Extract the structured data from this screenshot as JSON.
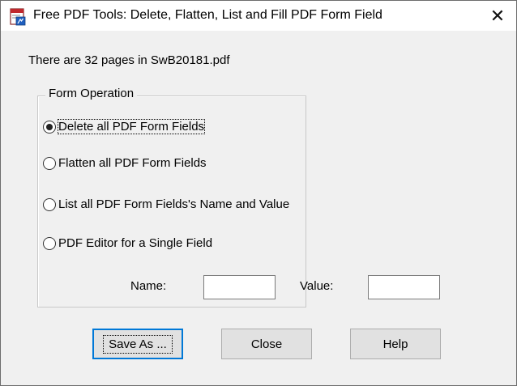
{
  "window": {
    "title": "Free PDF Tools: Delete, Flatten, List and Fill PDF Form Field",
    "app_icon": "pdf-tools-icon",
    "close_glyph": "✕"
  },
  "info": {
    "text": "There are 32 pages in SwB20181.pdf"
  },
  "form_operation": {
    "legend": "Form Operation",
    "options": [
      {
        "label": "Delete all PDF Form Fields",
        "selected": true
      },
      {
        "label": "Flatten all PDF Form Fields",
        "selected": false
      },
      {
        "label": "List all PDF Form Fields's Name and Value",
        "selected": false
      },
      {
        "label": "PDF Editor for a Single Field",
        "selected": false
      }
    ],
    "name_label": "Name:",
    "name_value": "",
    "value_label": "Value:",
    "value_value": ""
  },
  "buttons": {
    "save_as": "Save As ...",
    "close": "Close",
    "help": "Help"
  },
  "colors": {
    "focus_border": "#0078d7",
    "window_bg": "#f0f0f0"
  }
}
